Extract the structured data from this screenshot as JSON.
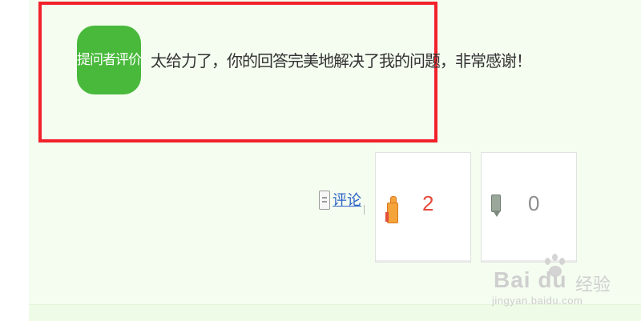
{
  "evaluation": {
    "badge_label": "提问者评价",
    "text": "太给力了，你的回答完美地解决了我的问题，非常感谢！"
  },
  "actions": {
    "comment_label": "评论",
    "upvote_count": "2",
    "downvote_count": "0"
  },
  "watermark": {
    "logo_text": "Bai du",
    "brand_text": "经验",
    "url_text": "jingyan.baidu.com"
  },
  "colors": {
    "highlight_border": "#f2222b",
    "badge_bg": "#49b93c",
    "panel_bg": "#f4fdf0",
    "link": "#2b63c6",
    "upvote_count": "#e64b3c"
  },
  "icons": {
    "comment": "comment-icon",
    "upvote": "thumbs-up-icon",
    "downvote": "thumbs-down-icon",
    "watermark_paw": "paw-icon"
  }
}
